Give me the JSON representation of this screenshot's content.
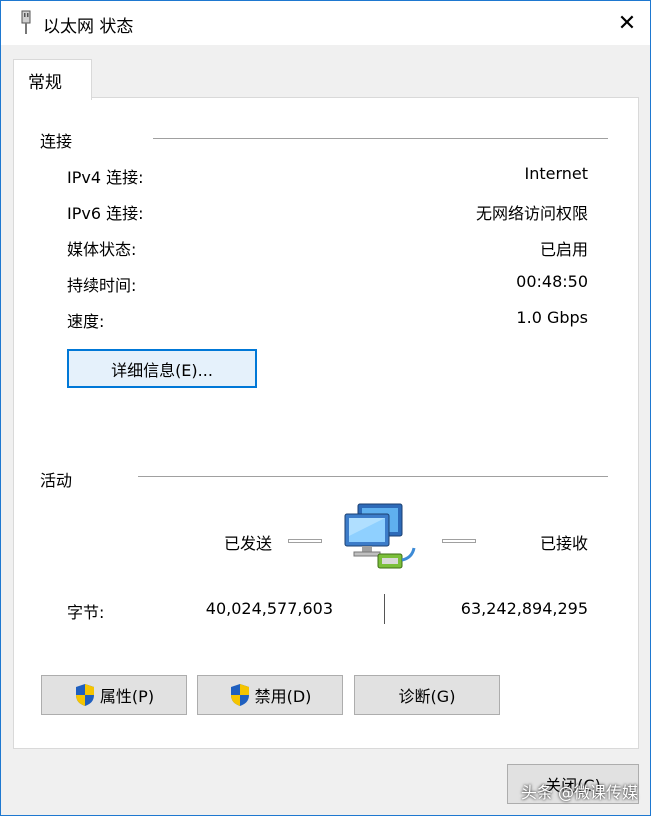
{
  "window": {
    "title": "以太网 状态",
    "close_glyph": "✕"
  },
  "tabs": [
    {
      "label": "常规"
    }
  ],
  "connection": {
    "group_label": "连接",
    "rows": [
      {
        "label": "IPv4 连接:",
        "value": "Internet"
      },
      {
        "label": "IPv6 连接:",
        "value": "无网络访问权限"
      },
      {
        "label": "媒体状态:",
        "value": "已启用"
      },
      {
        "label": "持续时间:",
        "value": "00:48:50"
      },
      {
        "label": "速度:",
        "value": "1.0 Gbps"
      }
    ],
    "details_button": "详细信息(E)..."
  },
  "activity": {
    "group_label": "活动",
    "sent_label": "已发送",
    "received_label": "已接收",
    "bytes_label": "字节:",
    "bytes_sent": "40,024,577,603",
    "bytes_received": "63,242,894,295",
    "icon": "network-computers-icon"
  },
  "buttons": {
    "properties": "属性(P)",
    "disable": "禁用(D)",
    "diagnose": "诊断(G)",
    "close": "关闭(C)"
  },
  "watermark": "头条 @微课传媒",
  "colors": {
    "accent": "#0078d7",
    "window_border": "#1e78d0",
    "panel_bg": "#ffffff",
    "dialog_bg": "#f0f0f0"
  }
}
